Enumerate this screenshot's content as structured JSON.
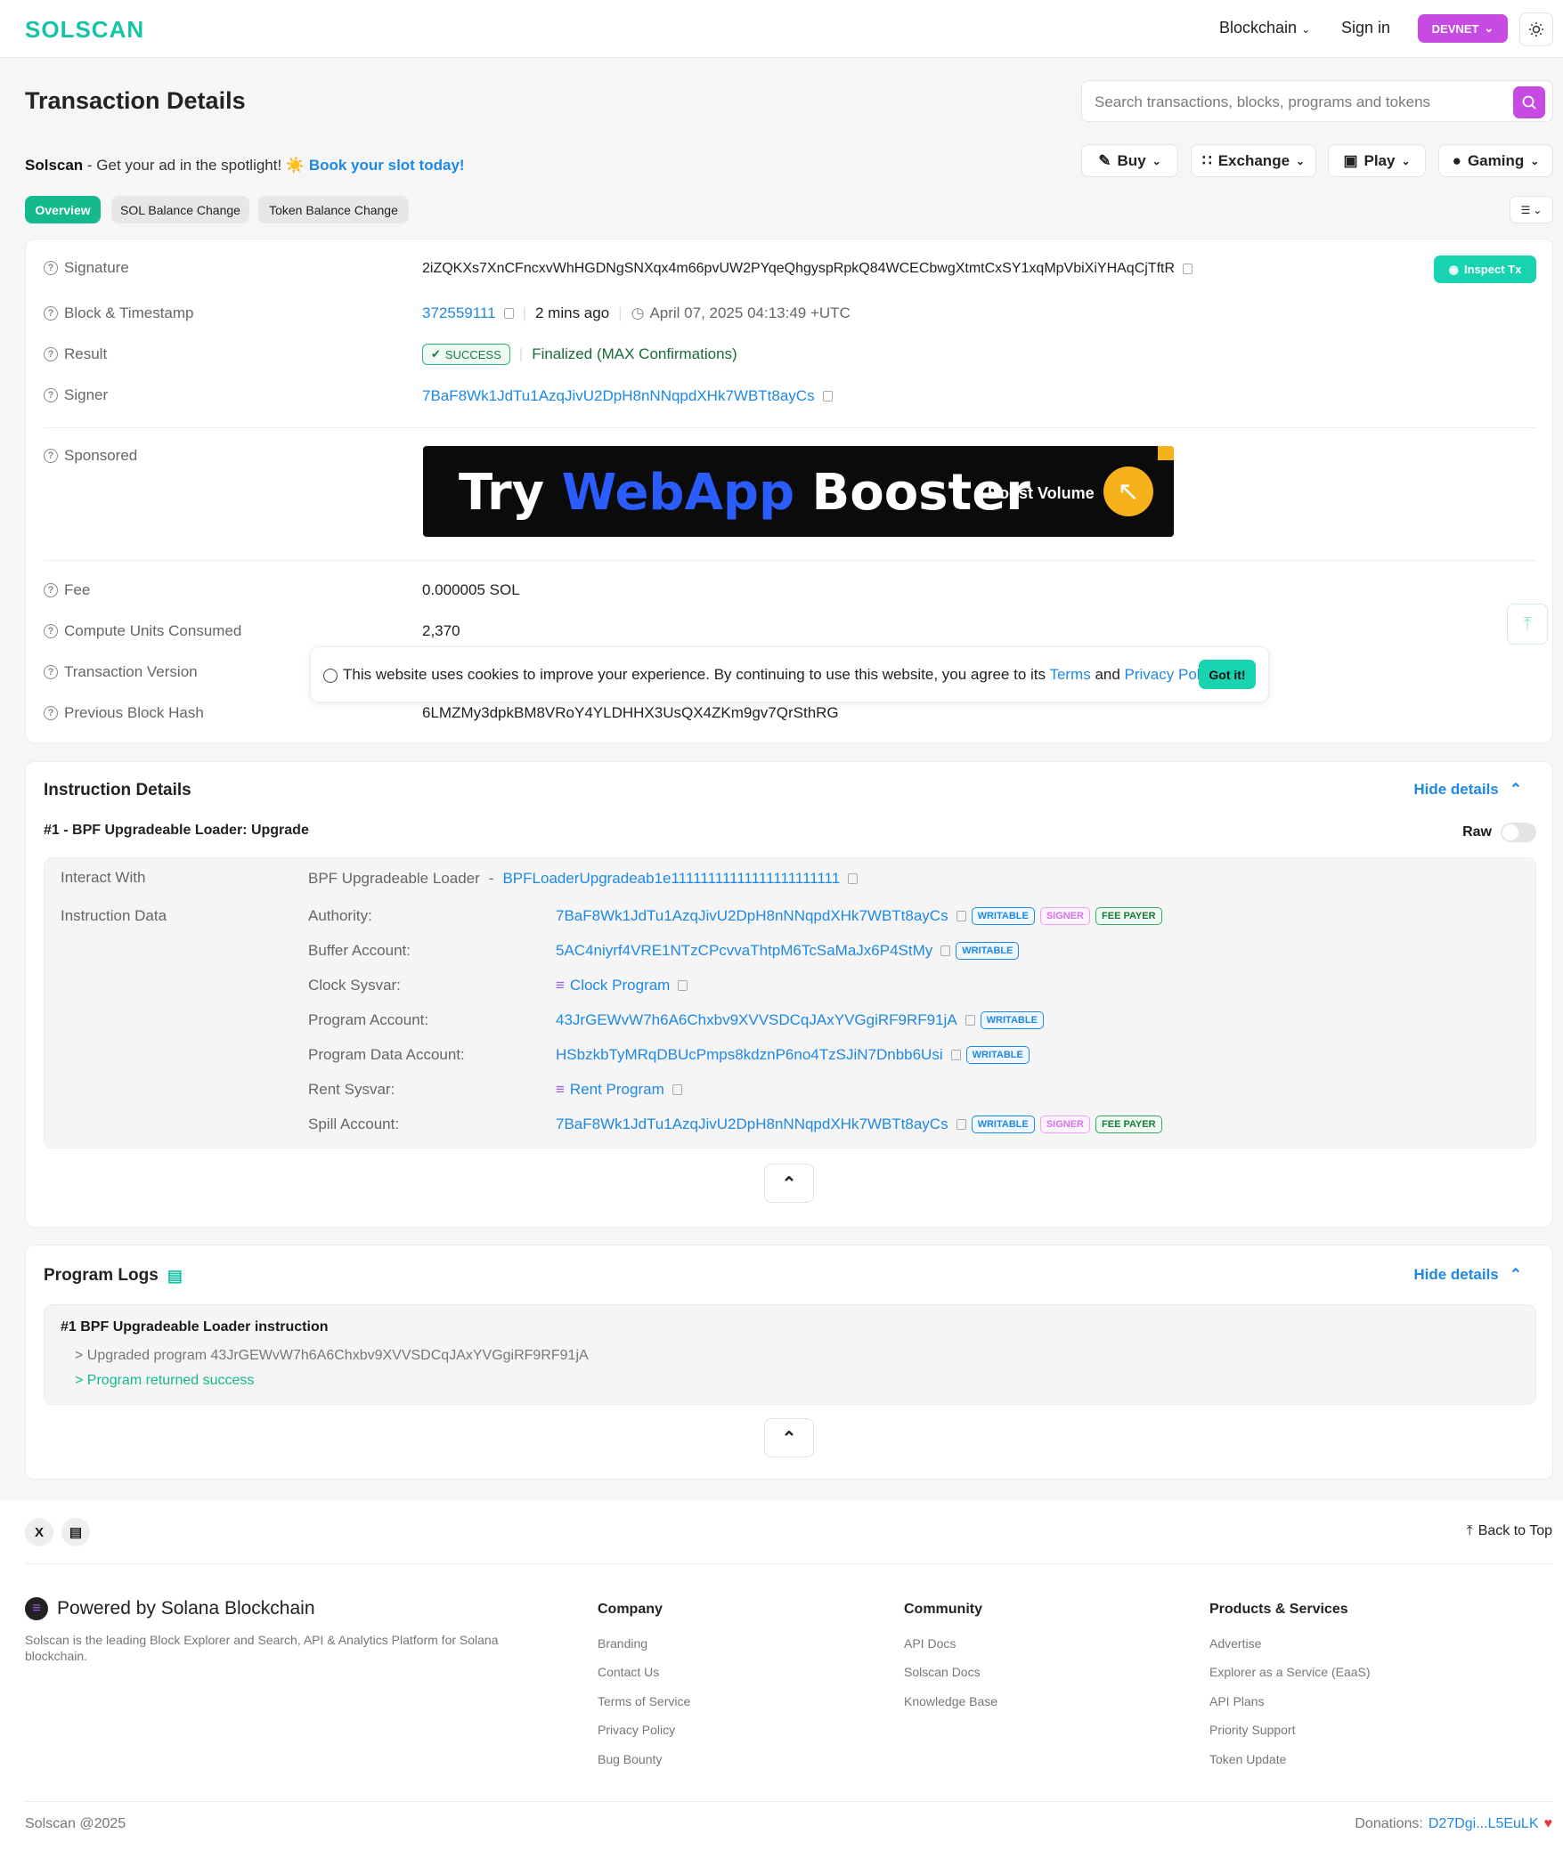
{
  "header": {
    "logo": "SOLSCAN",
    "nav_blockchain": "Blockchain",
    "sign_in": "Sign in",
    "network": "DEVNET"
  },
  "page": {
    "title": "Transaction Details",
    "search_placeholder": "Search transactions, blocks, programs and tokens",
    "ad_brand": "Solscan",
    "ad_text": " - Get your ad in the spotlight! ☀️ ",
    "ad_cta": "Book your slot today!",
    "menus": [
      "Buy",
      "Exchange",
      "Play",
      "Gaming"
    ],
    "tabs": [
      "Overview",
      "SOL Balance Change",
      "Token Balance Change"
    ]
  },
  "overview": {
    "signature_label": "Signature",
    "signature": "2iZQKXs7XnCFncxvWhHGDNgSNXqx4m66pvUW2PYqeQhgyspRpkQ84WCECbwgXtmtCxSY1xqMpVbiXiYHAqCjTftR",
    "inspect": "Inspect Tx",
    "block_label": "Block & Timestamp",
    "block": "372559111",
    "ago": "2 mins ago",
    "timestamp": "April 07, 2025 04:13:49 +UTC",
    "result_label": "Result",
    "result": "SUCCESS",
    "finalized": "Finalized (MAX Confirmations)",
    "signer_label": "Signer",
    "signer": "7BaF8Wk1JdTu1AzqJivU2DpH8nNNqpdXHk7WBTt8ayCs",
    "sponsored_label": "Sponsored",
    "banner_try": "Try",
    "banner_webapp": "WebApp",
    "banner_booster": "Booster",
    "banner_boost": "Boost Volume",
    "fee_label": "Fee",
    "fee": "0.000005 SOL",
    "cu_label": "Compute Units Consumed",
    "cu": "2,370",
    "version_label": "Transaction Version",
    "prev_label": "Previous Block Hash",
    "prev": "6LMZMy3dpkBM8VRoY4YLDHHX3UsQX4ZKm9gv7QrSthRG"
  },
  "cookie": {
    "text": "This website uses cookies to improve your experience. By continuing to use this website, you agree to its ",
    "terms": "Terms",
    "and": " and ",
    "privacy": "Privacy Policy",
    "dot": ".",
    "button": "Got it!"
  },
  "instructions": {
    "title": "Instruction Details",
    "hide": "Hide details",
    "item_title": "#1 - BPF Upgradeable Loader: Upgrade",
    "raw": "Raw",
    "interact_label": "Interact With",
    "interact_name": "BPF Upgradeable Loader",
    "interact_dash": "-",
    "interact_addr": "BPFLoaderUpgradeab1e11111111111111111111111",
    "data_label": "Instruction Data",
    "rows": [
      {
        "label": "Authority:",
        "value": "7BaF8Wk1JdTu1AzqJivU2DpH8nNNqpdXHk7WBTt8ayCs"
      },
      {
        "label": "Buffer Account:",
        "value": "5AC4niyrf4VRE1NTzCPcvvaThtpM6TcSaMaJx6P4StMy"
      },
      {
        "label": "Clock Sysvar:",
        "value": "Clock Program"
      },
      {
        "label": "Program Account:",
        "value": "43JrGEWvW7h6A6Chxbv9XVVSDCqJAxYVGgiRF9RF91jA"
      },
      {
        "label": "Program Data Account:",
        "value": "HSbzkbTyMRqDBUcPmps8kdznP6no4TzSJiN7Dnbb6Usi"
      },
      {
        "label": "Rent Sysvar:",
        "value": "Rent Program"
      },
      {
        "label": "Spill Account:",
        "value": "7BaF8Wk1JdTu1AzqJivU2DpH8nNNqpdXHk7WBTt8ayCs"
      }
    ],
    "badge_writable": "WRITABLE",
    "badge_signer": "SIGNER",
    "badge_fee": "FEE PAYER"
  },
  "logs": {
    "title": "Program Logs",
    "hide": "Hide details",
    "item_title": "#1 BPF Upgradeable Loader instruction",
    "line1": "> Upgraded program 43JrGEWvW7h6A6Chxbv9XVVSDCqJAxYVGgiRF9RF91jA",
    "line2": "> Program returned success"
  },
  "footer": {
    "back_to_top": "Back to Top",
    "powered": "Powered by Solana Blockchain",
    "desc": "Solscan is the leading Block Explorer and Search, API & Analytics Platform for Solana blockchain.",
    "company_title": "Company",
    "company": [
      "Branding",
      "Contact Us",
      "Terms of Service",
      "Privacy Policy",
      "Bug Bounty"
    ],
    "community_title": "Community",
    "community": [
      "API Docs",
      "Solscan Docs",
      "Knowledge Base"
    ],
    "products_title": "Products & Services",
    "products": [
      "Advertise",
      "Explorer as a Service (EaaS)",
      "API Plans",
      "Priority Support",
      "Token Update"
    ],
    "copyright": "Solscan @2025",
    "donations_label": "Donations:",
    "donations_addr": "D27Dgi...L5EuLK"
  },
  "colors": {
    "accent": "#14c4a4",
    "devnet": "#c74ae3",
    "link": "#1e88e5"
  }
}
